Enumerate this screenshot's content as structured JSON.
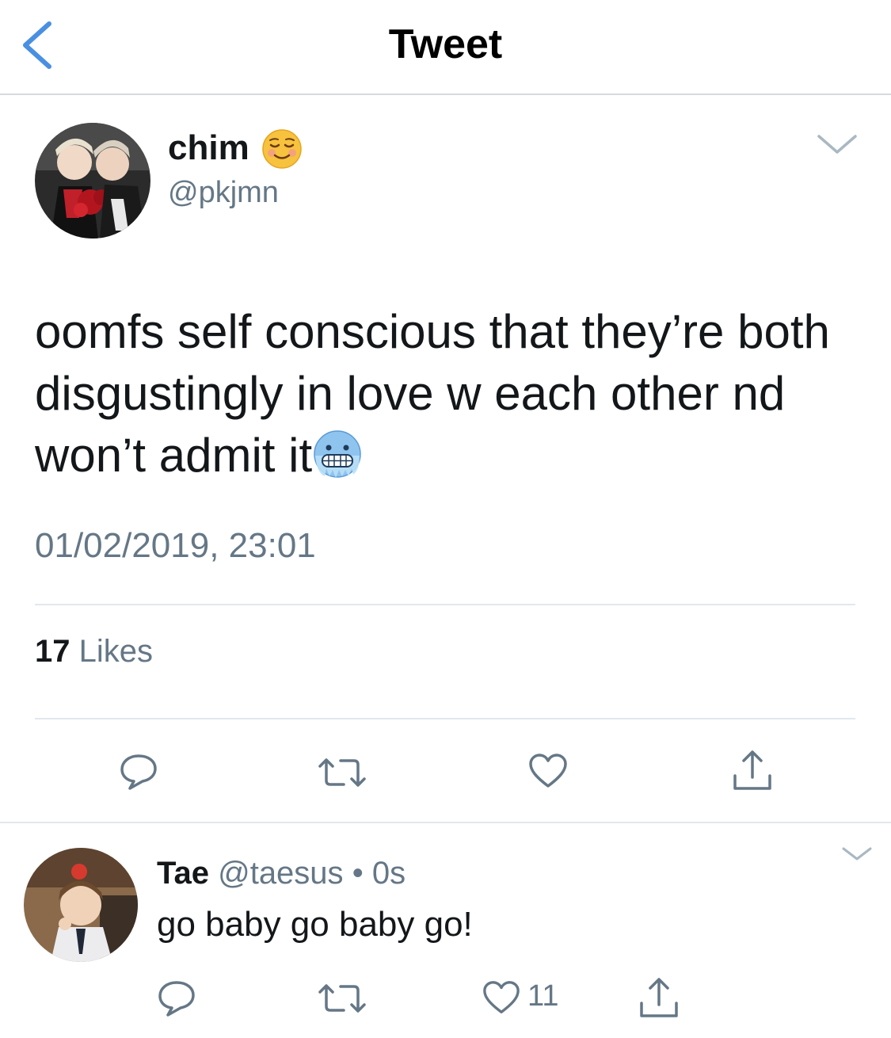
{
  "header": {
    "title": "Tweet",
    "back_icon": "back-chevron-icon",
    "accent": "#4a90e2"
  },
  "tweet": {
    "author_name": "chim",
    "author_emoji": "smiling-face-emoji",
    "author_handle": "@pkjmn",
    "text": "oomfs self conscious that they’re both disgustingly in love w each other nd won’t admit it",
    "text_emoji": "cold-face-emoji",
    "timestamp": "01/02/2019, 23:01",
    "likes_count": "17",
    "likes_label": "Likes"
  },
  "reply": {
    "author_name": "Tae",
    "author_handle": "@taesus",
    "separator": "•",
    "time": "0s",
    "text": "go baby go baby go!",
    "like_count": "11"
  },
  "colors": {
    "text": "#14171a",
    "secondary": "#657786",
    "divider": "#e1e8ed",
    "icon": "#657786"
  }
}
